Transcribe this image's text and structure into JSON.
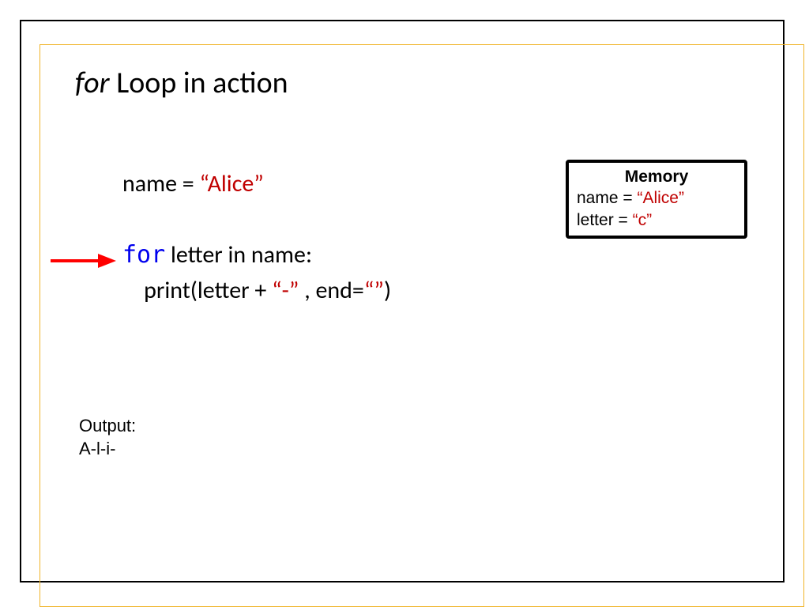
{
  "title": {
    "keyword": "for",
    "rest": " Loop in action"
  },
  "code": {
    "line1_pre": "name = ",
    "line1_str": "“Alice”",
    "line2_kw": "for",
    "line2_rest": " letter in name:",
    "line3_pre": "    print(letter + ",
    "line3_dash": "“-”",
    "line3_mid": " , end=",
    "line3_empty": "“”",
    "line3_end": ")"
  },
  "memory": {
    "title": "Memory",
    "nameLabel": "name = ",
    "nameValue": "“Alice”",
    "letterLabel": "letter = ",
    "letterValue": "“c”"
  },
  "output": {
    "label": "Output:",
    "value": "A-l-i-"
  }
}
